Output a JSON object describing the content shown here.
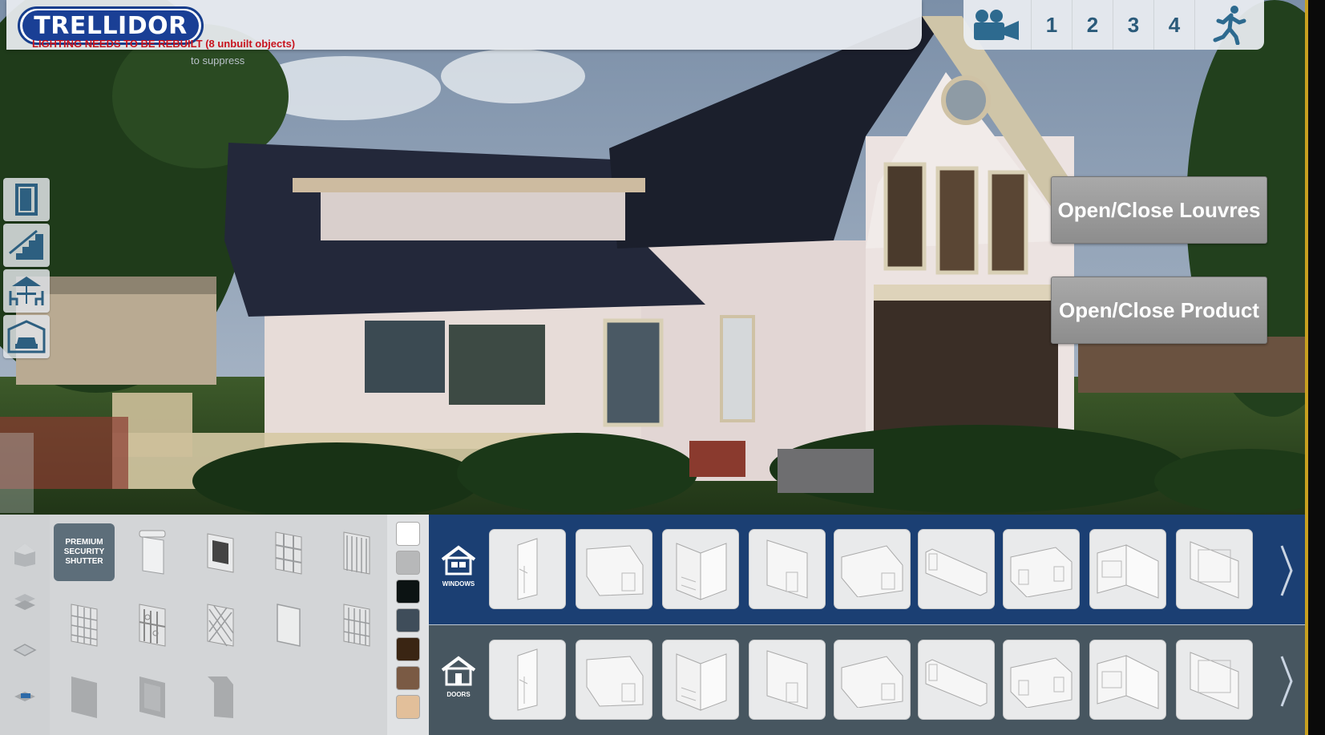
{
  "header": {
    "logo_text": "TRELLIDOR",
    "warning": "LIGHTING NEEDS TO BE REBUILT (8 unbuilt objects)",
    "suppress_hint": "to suppress"
  },
  "camera_bar": {
    "buttons": [
      {
        "name": "camera-icon",
        "label": ""
      },
      {
        "name": "view-1",
        "label": "1"
      },
      {
        "name": "view-2",
        "label": "2"
      },
      {
        "name": "view-3",
        "label": "3"
      },
      {
        "name": "view-4",
        "label": "4"
      },
      {
        "name": "walk-mode-icon",
        "label": ""
      }
    ]
  },
  "side_menu": {
    "items": [
      "door-icon",
      "staircase-icon",
      "patio-icon",
      "garage-icon"
    ]
  },
  "actions": {
    "louvres_label": "Open/Close Louvres",
    "product_label": "Open/Close Product"
  },
  "product_panel": {
    "categories": [
      "house-shape-icon",
      "layers-icon",
      "tray-icon",
      "shutter-product-icon"
    ],
    "selected_label": "PREMIUM SECURITY SHUTTER",
    "products": [
      "premium-security-shutter",
      "roller-shutter",
      "window-grille",
      "trellis-gate",
      "diamond-gate",
      "grid-gate",
      "ornate-gate",
      "patterned-gate",
      "plain-panel",
      "lattice-gate",
      "solid-panel",
      "framed-panel",
      "angled-panel"
    ]
  },
  "swatches": {
    "colors": [
      "#ffffff",
      "#b7b8b9",
      "#0c1313",
      "#3f4d5a",
      "#3a2513",
      "#7a5a44",
      "#e2bf9a"
    ]
  },
  "rows": [
    {
      "label": "WINDOWS",
      "items": 9
    },
    {
      "label": "DOORS",
      "items": 9
    }
  ]
}
